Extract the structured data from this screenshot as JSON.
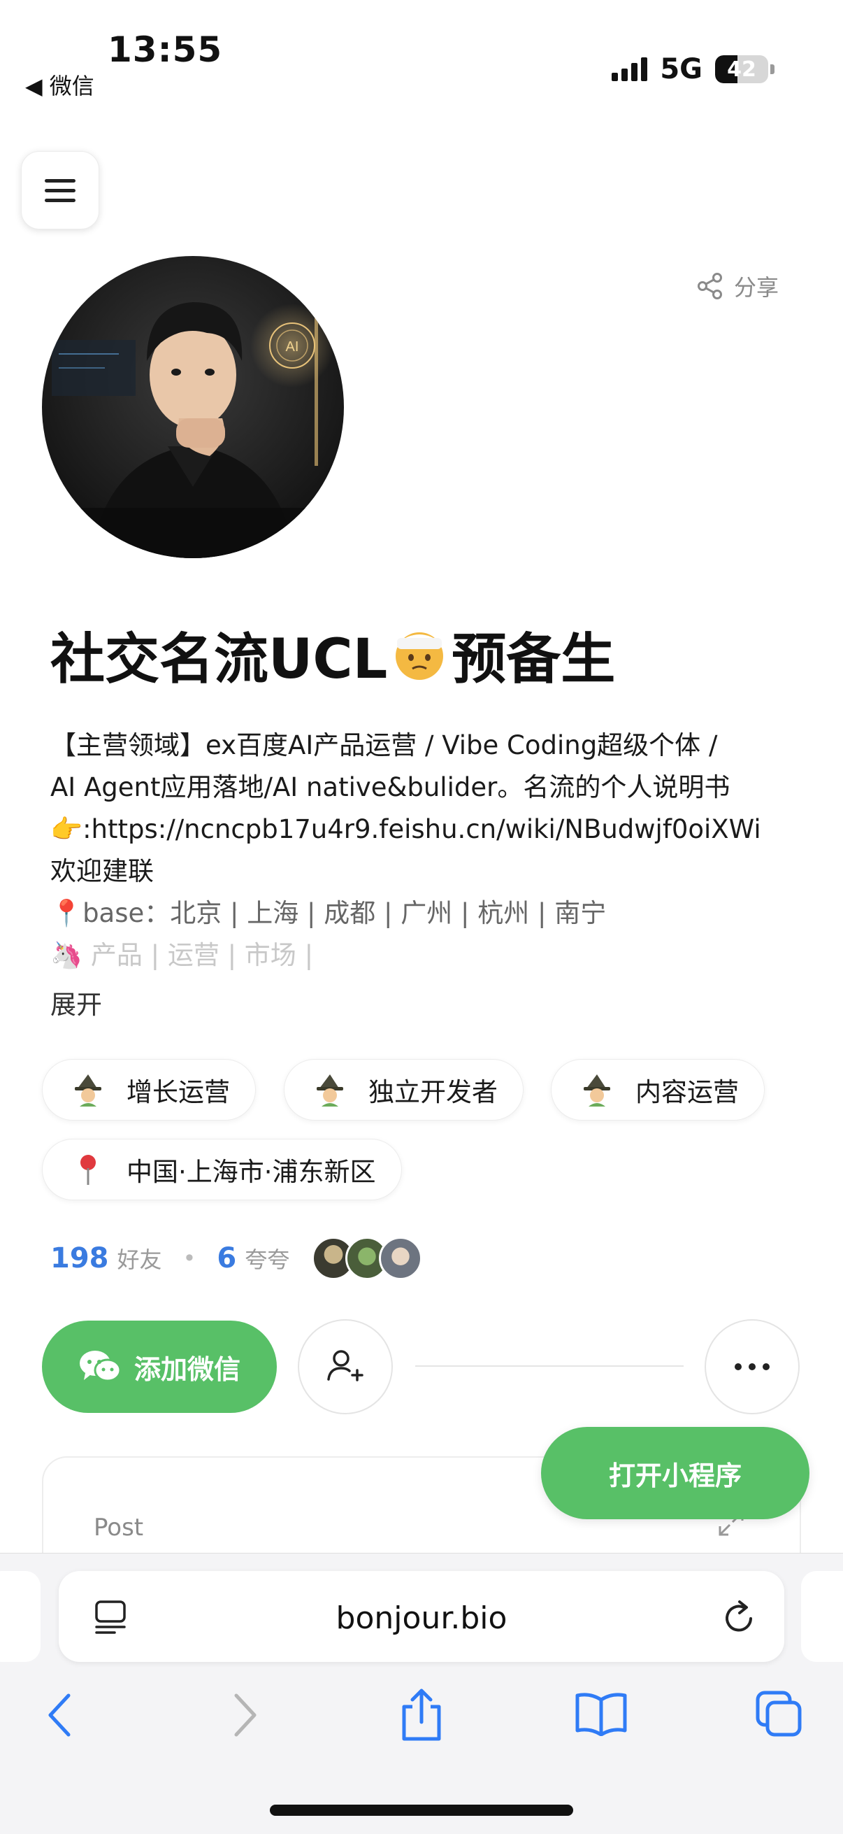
{
  "status": {
    "time": "13:55",
    "back_label": "◀ 微信",
    "network": "5G",
    "battery": "42",
    "battery_level": 0.42
  },
  "header": {
    "menu_icon": "hamburger-icon",
    "share_label": "分享"
  },
  "profile": {
    "name_part1": "社交名流UCL",
    "name_emoji": "🤕",
    "name_part2": "预备生",
    "bio_lines": [
      "【主营领域】ex百度AI产品运营 / Vibe Coding超级个体 /",
      "AI Agent应用落地/AI native&bulider。名流的个人说明书",
      "👉:https://ncncpb17u4r9.feishu.cn/wiki/NBudwjf0oiXWi",
      "欢迎建联",
      "📍base：北京 | 上海 | 成都 | 广州 | 杭州 | 南宁",
      "🦄 产品 | 运营 | 市场 |"
    ],
    "expand_label": "展开"
  },
  "tags": [
    {
      "icon": "witch-icon",
      "label": "增长运营"
    },
    {
      "icon": "witch-icon",
      "label": "独立开发者"
    },
    {
      "icon": "witch-icon",
      "label": "内容运营"
    },
    {
      "icon": "location-pin-icon",
      "label": "中国·上海市·浦东新区"
    }
  ],
  "stats": {
    "friends_count": "198",
    "friends_label": "好友",
    "praise_count": "6",
    "praise_label": "夸夸"
  },
  "actions": {
    "add_wechat_label": "添加微信",
    "open_miniprogram_label": "打开小程序"
  },
  "post": {
    "label": "Post"
  },
  "browser": {
    "url": "bonjour.bio"
  },
  "colors": {
    "accent_green": "#58c067",
    "link_blue": "#3a7be0"
  }
}
